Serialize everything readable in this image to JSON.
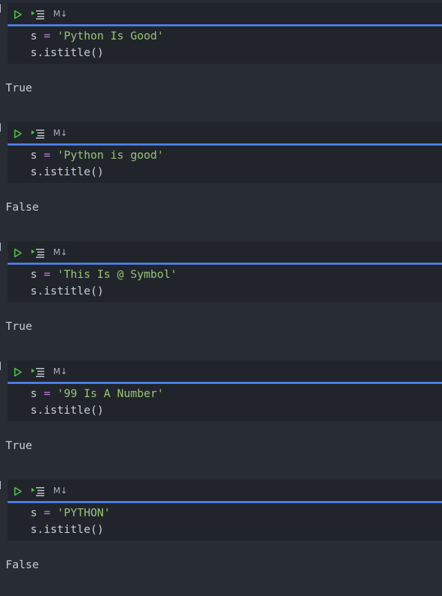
{
  "toolbar": {
    "markdown_label": "M↓"
  },
  "colors": {
    "background": "#282c34",
    "cell_bg": "#21252b",
    "accent": "#4d7fe6",
    "string": "#98c379",
    "operator": "#c678dd",
    "text": "#c8ccd4",
    "run_icon": "#4ec94e"
  },
  "icons": {
    "run": "play-icon",
    "run_all": "run-all-icon"
  },
  "cells": [
    {
      "var": "s",
      "op": "=",
      "string": "'Python Is Good'",
      "call": "s.istitle()",
      "output": "True"
    },
    {
      "var": "s",
      "op": "=",
      "string": "'Python is good'",
      "call": "s.istitle()",
      "output": "False"
    },
    {
      "var": "s",
      "op": "=",
      "string": "'This Is @ Symbol'",
      "call": "s.istitle()",
      "output": "True"
    },
    {
      "var": "s",
      "op": "=",
      "string": "'99 Is A Number'",
      "call": "s.istitle()",
      "output": "True"
    },
    {
      "var": "s",
      "op": "=",
      "string": "'PYTHON'",
      "call": "s.istitle()",
      "output": "False"
    }
  ]
}
